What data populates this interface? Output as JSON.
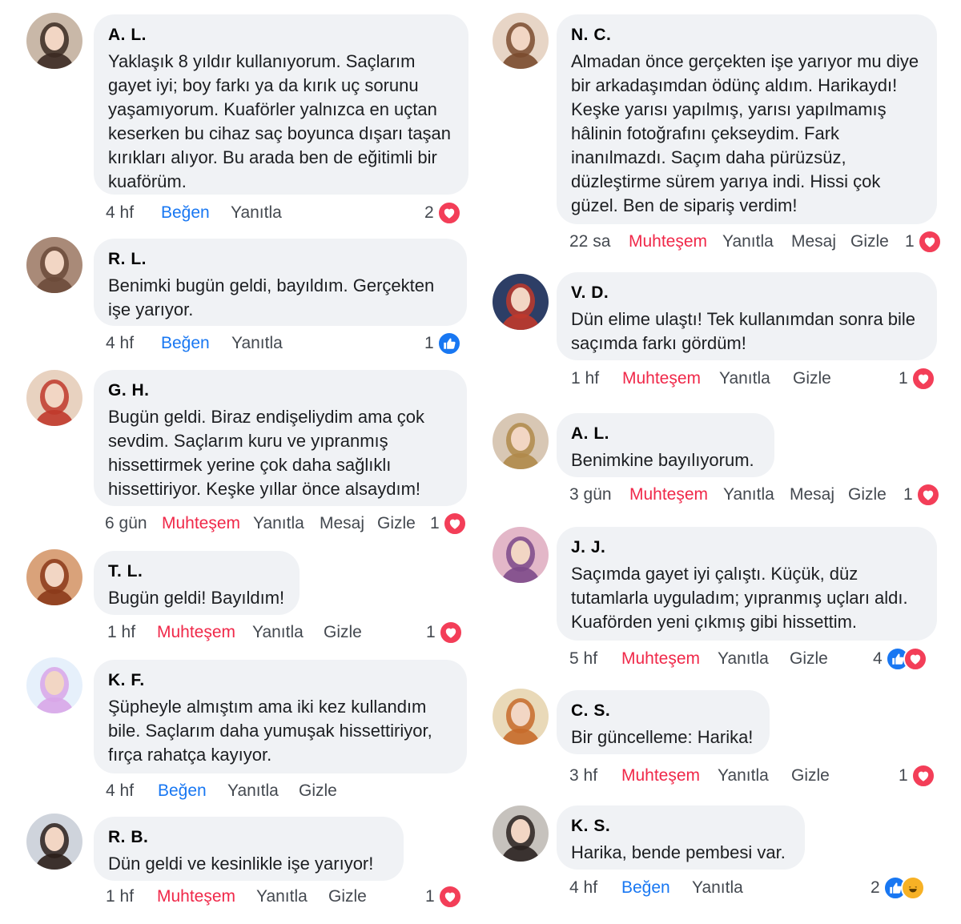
{
  "comments": [
    {
      "author": "A. L.",
      "text": "Yaklaşık 8 yıldır kullanıyorum. Saçlarım gayet iyi; boy farkı ya da kırık uç sorunu yaşamıyorum. Kuaförler yalnızca en uçtan keserken bu cihaz saç boyunca dışarı taşan kırıkları alıyor. Bu arada ben de eğitimli bir kuaförüm.",
      "time": "4 hf",
      "reaction_label": "Beğen",
      "reply": "Yanıtla",
      "count": "2",
      "reactions": [
        "love"
      ],
      "avatar_colors": [
        "#c9b8a8",
        "#3b2a22"
      ]
    },
    {
      "author": "R. L.",
      "text": "Benimki bugün geldi, bayıldım. Gerçekten işe yarıyor.",
      "time": "4 hf",
      "reaction_label": "Beğen",
      "reply": "Yanıtla",
      "count": "1",
      "reactions": [
        "like"
      ],
      "avatar_colors": [
        "#a98a78",
        "#6b4a3a"
      ]
    },
    {
      "author": "G. H.",
      "text": "Bugün geldi. Biraz endişeliydim ama çok sevdim. Saçlarım kuru ve yıpranmış hissettirmek yerine çok daha sağlıklı hissettiriyor. Keşke yıllar önce alsaydım!",
      "time": "6 gün",
      "reaction_label": "Muhteşem",
      "reply": "Yanıtla",
      "message": "Mesaj",
      "hide": "Gizle",
      "count": "1",
      "reactions": [
        "love"
      ],
      "avatar_colors": [
        "#e8d2c0",
        "#c0392b"
      ]
    },
    {
      "author": "T. L.",
      "text": "Bugün geldi! Bayıldım!",
      "time": "1 hf",
      "reaction_label": "Muhteşem",
      "reply": "Yanıtla",
      "hide": "Gizle",
      "count": "1",
      "reactions": [
        "love"
      ],
      "avatar_colors": [
        "#d9a27a",
        "#8b3a1a"
      ]
    },
    {
      "author": "K. F.",
      "text": "Şüpheyle almıştım ama iki kez kullandım bile. Saçlarım daha yumuşak hissettiriyor, fırça rahatça kayıyor.",
      "time": "4 hf",
      "reaction_label": "Beğen",
      "reply": "Yanıtla",
      "hide": "Gizle",
      "count": "",
      "reactions": [],
      "avatar_colors": [
        "#e6f0fb",
        "#d8a6e8"
      ]
    },
    {
      "author": "R. B.",
      "text": "Dün geldi ve kesinlikle işe yarıyor!",
      "time": "1 hf",
      "reaction_label": "Muhteşem",
      "reply": "Yanıtla",
      "hide": "Gizle",
      "count": "1",
      "reactions": [
        "love"
      ],
      "avatar_colors": [
        "#cfd4dc",
        "#2b1f1a"
      ]
    },
    {
      "author": "N. C.",
      "text": "Almadan önce gerçekten işe yarıyor mu diye bir arkadaşımdan ödünç aldım. Harikaydı! Keşke yarısı yapılmış, yarısı yapılmamış hâlinin fotoğrafını çekseydim. Fark inanılmazdı. Saçım daha pürüzsüz, düzleştirme sürem yarıya indi. Hissi çok güzel. Ben de sipariş verdim!",
      "time": "22 sa",
      "reaction_label": "Muhteşem",
      "reply": "Yanıtla",
      "message": "Mesaj",
      "hide": "Gizle",
      "count": "1",
      "reactions": [
        "love"
      ],
      "avatar_colors": [
        "#e7d5c6",
        "#7a4b2e"
      ]
    },
    {
      "author": "V. D.",
      "text": "Dün elime ulaştı! Tek kullanımdan sonra bile saçımda farkı gördüm!",
      "time": "1 hf",
      "reaction_label": "Muhteşem",
      "reply": "Yanıtla",
      "hide": "Gizle",
      "count": "1",
      "reactions": [
        "love"
      ],
      "avatar_colors": [
        "#2d3e66",
        "#c0392b"
      ]
    },
    {
      "author": "A. L.",
      "text": "Benimkine bayılıyorum.",
      "time": "3 gün",
      "reaction_label": "Muhteşem",
      "reply": "Yanıtla",
      "message": "Mesaj",
      "hide": "Gizle",
      "count": "1",
      "reactions": [
        "love"
      ],
      "avatar_colors": [
        "#d8c7b4",
        "#b08a4a"
      ]
    },
    {
      "author": "J. J.",
      "text": "Saçımda gayet iyi çalıştı. Küçük, düz tutamlarla uyguladım; yıpranmış uçları aldı. Kuaförden yeni çıkmış gibi hissettim.",
      "time": "5 hf",
      "reaction_label": "Muhteşem",
      "reply": "Yanıtla",
      "hide": "Gizle",
      "count": "4",
      "reactions": [
        "like",
        "love"
      ],
      "avatar_colors": [
        "#e3b7c8",
        "#7d4a8a"
      ]
    },
    {
      "author": "C. S.",
      "text": "Bir güncelleme: Harika!",
      "time": "3 hf",
      "reaction_label": "Muhteşem",
      "reply": "Yanıtla",
      "hide": "Gizle",
      "count": "1",
      "reactions": [
        "love"
      ],
      "avatar_colors": [
        "#e9d9b8",
        "#c76a2a"
      ]
    },
    {
      "author": "K. S.",
      "text": "Harika, bende pembesi var.",
      "time": "4 hf",
      "reaction_label": "Beğen",
      "reply": "Yanıtla",
      "count": "2",
      "reactions": [
        "like",
        "haha"
      ],
      "avatar_colors": [
        "#c6c2bd",
        "#2a2220"
      ]
    }
  ],
  "colors": {
    "bubble": "#f0f2f5",
    "like": "#1877f2",
    "love": "#f02849",
    "muted": "#65676b"
  }
}
